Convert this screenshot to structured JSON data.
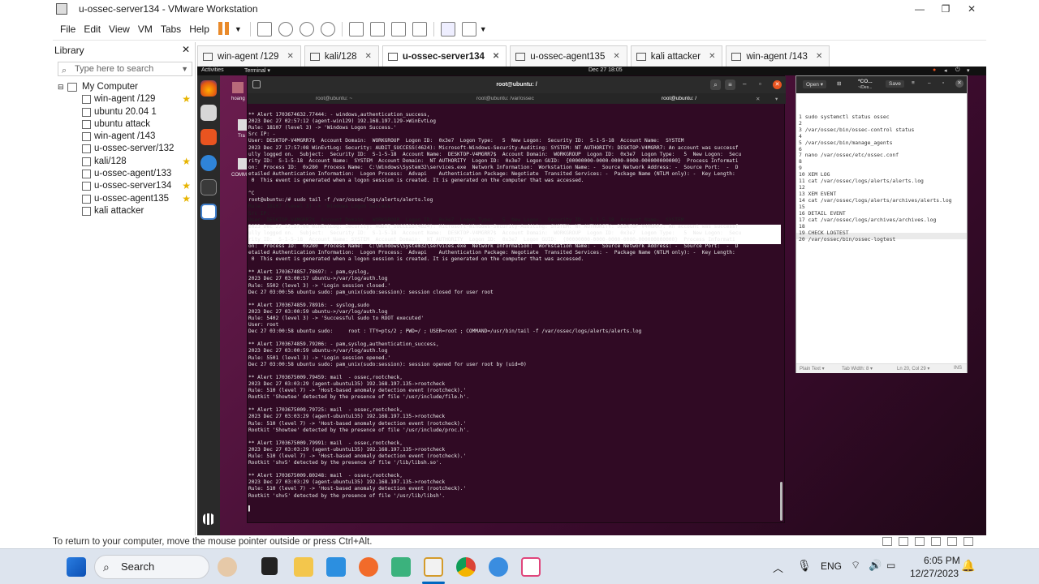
{
  "window": {
    "title": "u-ossec-server134 - VMware Workstation"
  },
  "menu": [
    "File",
    "Edit",
    "View",
    "VM",
    "Tabs",
    "Help"
  ],
  "library": {
    "title": "Library",
    "search_placeholder": "Type here to search",
    "root": "My Computer",
    "items": [
      {
        "label": "win-agent /129",
        "starred": true
      },
      {
        "label": "ubuntu 20.04 1",
        "starred": false
      },
      {
        "label": "ubuntu attack",
        "starred": false
      },
      {
        "label": "win-agent /143",
        "starred": false
      },
      {
        "label": "u-ossec-server/132",
        "starred": false
      },
      {
        "label": "kali/128",
        "starred": true
      },
      {
        "label": "u-ossec-agent/133",
        "starred": false
      },
      {
        "label": "u-ossec-server134",
        "starred": true
      },
      {
        "label": "u-ossec-agent135",
        "starred": true
      },
      {
        "label": "kali attacker",
        "starred": false
      }
    ]
  },
  "tabs": [
    {
      "label": "win-agent /129",
      "active": false
    },
    {
      "label": "kali/128",
      "active": false
    },
    {
      "label": "u-ossec-server134",
      "active": true
    },
    {
      "label": "u-ossec-agent135",
      "active": false
    },
    {
      "label": "kali attacker",
      "active": false
    },
    {
      "label": "win-agent /143",
      "active": false
    }
  ],
  "guest": {
    "topbar": {
      "activities": "Activities",
      "app": "Terminal ▾",
      "clock": "Dec 27  18:05"
    },
    "terminal": {
      "title": "root@ubuntu: /",
      "tabs": [
        "root@ubuntu: ~",
        "root@ubuntu: /var/ossec",
        "root@ubuntu: /"
      ],
      "lines": [
        "",
        "** Alert 1703674632.77444: - windows,authentication_success,",
        "2023 Dec 27 02:57:12 (agent-win129) 192.168.197.129->WinEvtLog",
        "Rule: 18107 (level 3) -> 'Windows Logon Success.'",
        "Src IP: -",
        "User: DESKTOP-V4MGRR7$  Account Domain:  WORKGROUP  Logon ID:  0x3e7  Logon Type:   5  New Logon:  Security ID:  S-1-5-18  Account Name:  SYSTEM",
        "2023 Dec 27 17:57:08 WinEvtLog: Security: AUDIT_SUCCESS(4624): Microsoft-Windows-Security-Auditing: SYSTEM: NT AUTHORITY: DESKTOP-V4MGRR7: An account was successf",
        "ully logged on.  Subject:  Security ID:  S-1-5-18  Account Name:  DESKTOP-V4MGRR7$  Account Domain:  WORKGROUP  Logon ID:  0x3e7  Logon Type:   5  New Logon:  Secu",
        "rity ID:  S-1-5-18  Account Name:  SYSTEM  Account Domain:  NT AUTHORITY  Logon ID:  0x3e7  Logon GUID:  {00000000-0000-0000-0000-000000000000}  Process Informati",
        "on:  Process ID:  0x280  Process Name:  C:\\Windows\\System32\\services.exe  Network Information:  Workstation Name: -  Source Network Address: -  Source Port:  -  D",
        "etailed Authentication Information:  Logon Process:  Advapi    Authentication Package: Negotiate  Transited Services: -  Package Name (NTLM only): -  Key Length:",
        " 0  This event is generated when a logon session is created. It is generated on the computer that was accessed.",
        "",
        "^C",
        "root@ubuntu:/# sudo tail -f /var/ossec/logs/alerts/alerts.log",
        "Rule: 18107 (level 3) -> 'Windows Logon Success.'",
        "Src IP: -",
        "User: DESKTOP-V4MGRR7$  Account Domain:  WORKGROUP  Logon ID:  0x3e7  Logon Type:   5  New Logon:  Security ID:  S-1-5-18  Account Name:  SYSTEM",
        "2023 Dec 27 17:57:08 WinEvtLog: Security: AUDIT_SUCCESS(4624): Microsoft-Windows-Security-Auditing: SYSTEM: NT AUTHORITY: DESKTOP-V4MGRR7: An account was successf",
        "ully logged on.  Subject:  Security ID:  S-1-5-18  Account Name:  DESKTOP-V4MGRR7$  Account Domain:  WORKGROUP  Logon ID:  0x3e7  Logon Type:   5  New Logon:  Secu",
        "rity ID:  S-1-5-18  Account Name: SYSTEM  Account Domain:  NT AUTHORITY  Logon ID:  0x3e7  Logon GUID:  {00000000-0000-0000-0000-000000000000}  Process Informati",
        "on:  Process ID:  0x280  Process Name:  C:\\Windows\\System32\\services.exe  Network Information:  Workstation Name: -  Source Network Address: -  Source Port:  -  D",
        "etailed Authentication Information:  Logon Process:  Advapi    Authentication Package: Negotiate  Transited Services: -  Package Name (NTLM only): -  Key Length:",
        " 0  This event is generated when a logon session is created. It is generated on the computer that was accessed.",
        "",
        "** Alert 1703674857.78697: - pam,syslog,",
        "2023 Dec 27 03:00:57 ubuntu->/var/log/auth.log",
        "Rule: 5502 (level 3) -> 'Login session closed.'",
        "Dec 27 03:00:56 ubuntu sudo: pam_unix(sudo:session): session closed for user root",
        "",
        "** Alert 1703674859.78916: - syslog,sudo",
        "2023 Dec 27 03:00:59 ubuntu->/var/log/auth.log",
        "Rule: 5402 (level 3) -> 'Successful sudo to ROOT executed'",
        "User: root",
        "Dec 27 03:00:58 ubuntu sudo:     root : TTY=pts/2 ; PWD=/ ; USER=root ; COMMAND=/usr/bin/tail -f /var/ossec/logs/alerts/alerts.log",
        "",
        "** Alert 1703674859.79206: - pam,syslog,authentication_success,",
        "2023 Dec 27 03:00:59 ubuntu->/var/log/auth.log",
        "Rule: 5501 (level 3) -> 'Login session opened.'",
        "Dec 27 03:00:58 ubuntu sudo: pam_unix(sudo:session): session opened for user root by (uid=0)",
        "",
        "** Alert 1703675009.79459: mail  - ossec,rootcheck,",
        "2023 Dec 27 03:03:29 (agent-ubuntu135) 192.168.197.135->rootcheck",
        "Rule: 510 (level 7) -> 'Host-based anomaly detection event (rootcheck).'",
        "Rootkit 'Showtee' detected by the presence of file '/usr/include/file.h'.",
        "",
        "** Alert 1703675009.79725: mail  - ossec,rootcheck,",
        "2023 Dec 27 03:03:29 (agent-ubuntu135) 192.168.197.135->rootcheck",
        "Rule: 510 (level 7) -> 'Host-based anomaly detection event (rootcheck).'",
        "Rootkit 'Showtee' detected by the presence of file '/usr/include/proc.h'.",
        "",
        "** Alert 1703675009.79991: mail  - ossec,rootcheck,",
        "2023 Dec 27 03:03:29 (agent-ubuntu135) 192.168.197.135->rootcheck",
        "Rule: 510 (level 7) -> 'Host-based anomaly detection event (rootcheck).'",
        "Rootkit 'shv5' detected by the presence of file '/lib/libsh.so'.",
        "",
        "** Alert 1703675009.80248: mail  - ossec,rootcheck,",
        "2023 Dec 27 03:03:29 (agent-ubuntu135) 192.168.197.135->rootcheck",
        "Rule: 510 (level 7) -> 'Host-based anomaly detection event (rootcheck).'",
        "Rootkit 'shv5' detected by the presence of file '/usr/lib/libsh'.",
        "",
        "▌"
      ]
    },
    "gedit": {
      "open": "Open ▾",
      "title": "*CO...",
      "subtitle": "~/Des...",
      "save": "Save",
      "lines": [
        "1 sudo systemctl status ossec",
        "2",
        "3 /var/ossec/bin/ossec-control status",
        "4",
        "5 /var/ossec/bin/manage_agents",
        "6",
        "7 nano /var/ossec/etc/ossec.conf",
        "8",
        "9",
        "10 XEM LOG",
        "11 cat /var/ossec/logs/alerts/alerts.log",
        "12",
        "13 XEM EVENT",
        "14 cat /var/ossec/logs/alerts/archives/alerts.log",
        "15",
        "16 DETAIL EVENT",
        "17 cat /var/ossec/logs/archives/archives.log",
        "18",
        "19 CHECK LOGTEST",
        "20 /var/ossec/bin/ossec-logtest"
      ],
      "status": {
        "mode": "Plain Text ▾",
        "tab": "Tab Width: 8 ▾",
        "pos": "Ln 20, Col 29 ▾",
        "ins": "INS"
      }
    },
    "desktop_labels": [
      "hoang",
      "Tra",
      "COMM"
    ]
  },
  "statusbar": "To return to your computer, move the mouse pointer outside or press Ctrl+Alt.",
  "taskbar": {
    "search": "Search",
    "lang": "ENG",
    "time": "6:05 PM",
    "date": "12/27/2023"
  },
  "colors": {
    "accent": "#e95420",
    "terminal_bg": "#300a24",
    "star": "#e7b400",
    "pause": "#e98a2a"
  }
}
